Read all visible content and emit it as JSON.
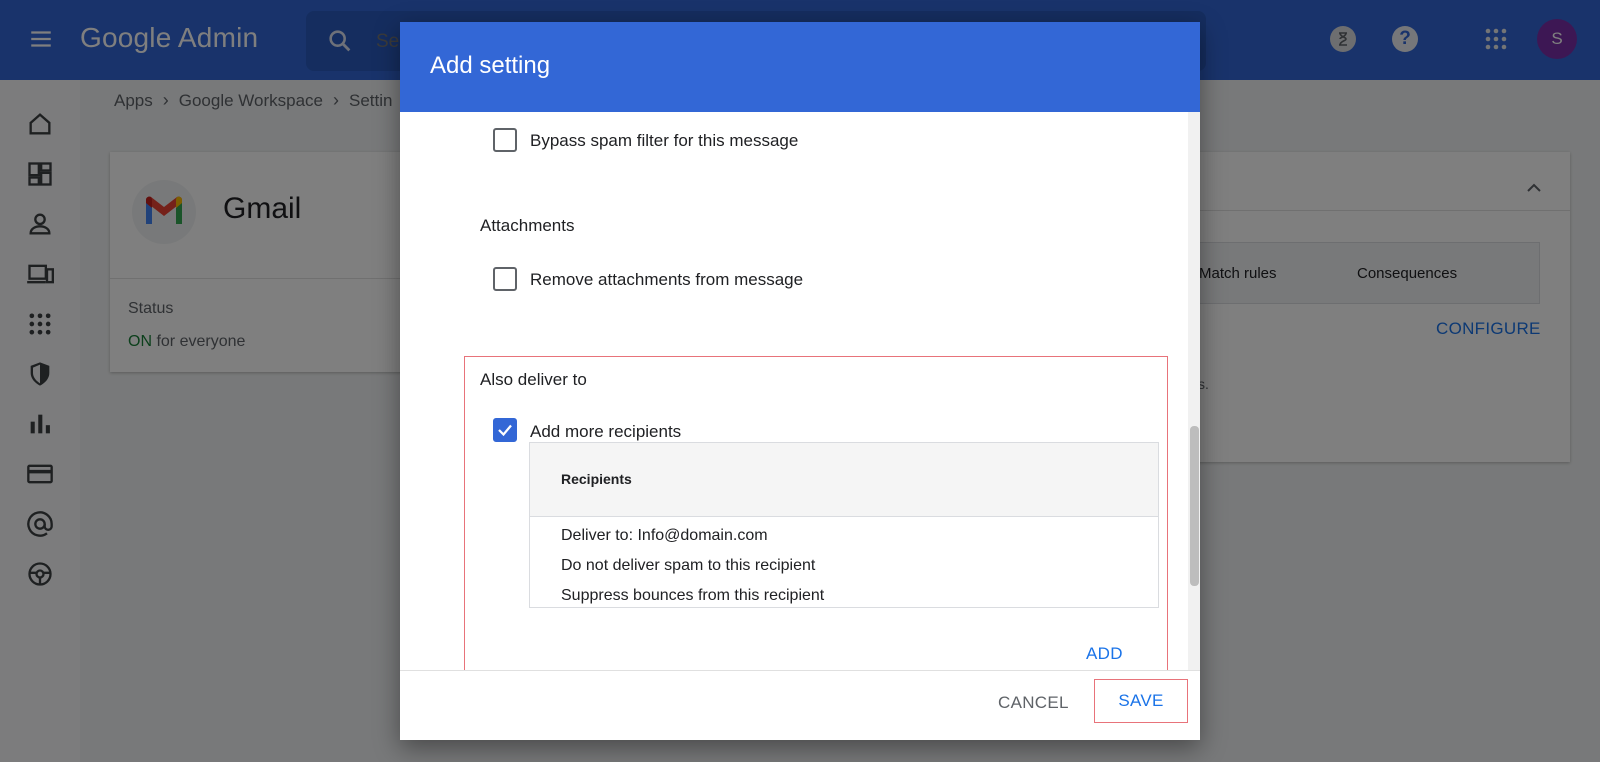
{
  "app": {
    "brand": "Google Admin"
  },
  "header": {
    "search_placeholder": "Se",
    "avatar_initial": "S",
    "help_glyph": "?"
  },
  "breadcrumb": {
    "items": [
      "Apps",
      "Google Workspace",
      "Settin"
    ]
  },
  "service_card": {
    "title": "Gmail",
    "status_label": "Status",
    "status_on": "ON",
    "status_suffix": " for everyone"
  },
  "rules_card": {
    "col_match": "Match rules",
    "col_consequences": "Consequences",
    "configure_label": "CONFIGURE",
    "trailing_text": "s."
  },
  "dialog": {
    "title": "Add setting",
    "bypass_spam": {
      "label": "Bypass spam filter for this message",
      "checked": false
    },
    "attachments_section": "Attachments",
    "remove_attachments": {
      "label": "Remove attachments from message",
      "checked": false
    },
    "also_deliver_section": "Also deliver to",
    "add_recipients": {
      "label": "Add more recipients",
      "checked": true
    },
    "recipients_table": {
      "header": "Recipients",
      "lines": [
        "Deliver to: Info@domain.com",
        "Do not deliver spam to this recipient",
        "Suppress bounces from this recipient"
      ]
    },
    "add_label": "ADD",
    "cancel_label": "CANCEL",
    "save_label": "SAVE"
  },
  "colors": {
    "topbar": "#3367d6",
    "accent_link": "#1a73e8",
    "highlight_border": "#e8737a",
    "status_on": "#188038",
    "avatar_bg": "#7b2fa8"
  },
  "icons": {
    "sidebar": [
      "home-icon",
      "dashboard-icon",
      "person-icon",
      "devices-icon",
      "apps-grid-icon",
      "security-shield-icon",
      "reports-chart-icon",
      "billing-card-icon",
      "at-sign-icon",
      "support-icon"
    ]
  }
}
